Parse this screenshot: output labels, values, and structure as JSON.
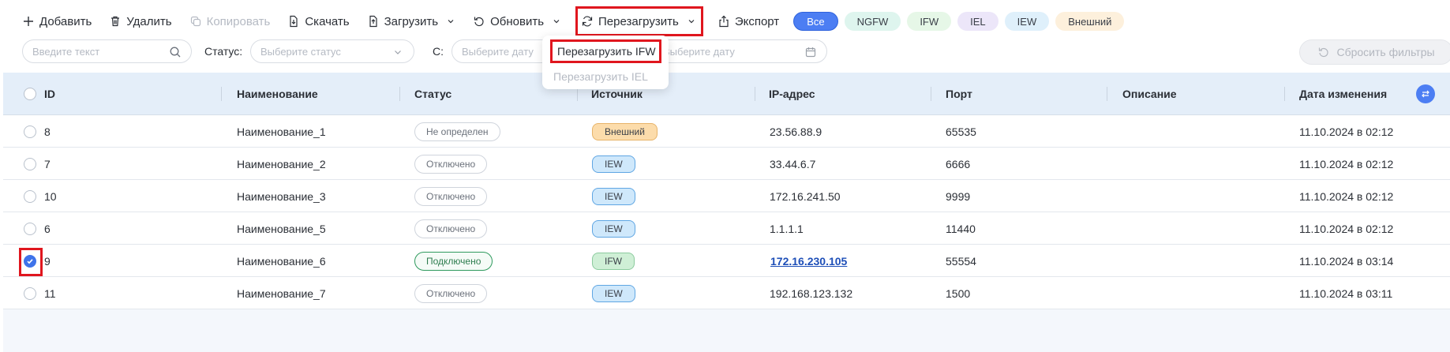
{
  "toolbar": {
    "add": "Добавить",
    "delete": "Удалить",
    "copy": "Копировать",
    "download": "Скачать",
    "upload": "Загрузить",
    "refresh": "Обновить",
    "reload": "Перезагрузить",
    "export": "Экспорт"
  },
  "chips": {
    "all": "Все",
    "ngfw": "NGFW",
    "ifw": "IFW",
    "iel": "IEL",
    "iew": "IEW",
    "ext": "Внешний"
  },
  "filters": {
    "search_placeholder": "Введите текст",
    "status_label": "Статус:",
    "status_placeholder": "Выберите статус",
    "from_label": "С:",
    "date_placeholder": "Выберите дату",
    "date_to_placeholder": "Выберите дату",
    "reset": "Сбросить фильтры"
  },
  "reload_menu": {
    "item_ifw": "Перезагрузить IFW",
    "item_iel": "Перезагрузить IEL"
  },
  "table": {
    "headers": {
      "id": "ID",
      "name": "Наименование",
      "status": "Статус",
      "source": "Источник",
      "ip": "IP-адрес",
      "port": "Порт",
      "description": "Описание",
      "modified": "Дата изменения"
    },
    "rows": [
      {
        "id": "8",
        "name": "Наименование_1",
        "status": "Не определен",
        "source": "Внешний",
        "ip": "23.56.88.9",
        "port": "65535",
        "description": "",
        "modified": "11.10.2024 в 02:12"
      },
      {
        "id": "7",
        "name": "Наименование_2",
        "status": "Отключено",
        "source": "IEW",
        "ip": "33.44.6.7",
        "port": "6666",
        "description": "",
        "modified": "11.10.2024 в 02:12"
      },
      {
        "id": "10",
        "name": "Наименование_3",
        "status": "Отключено",
        "source": "IEW",
        "ip": "172.16.241.50",
        "port": "9999",
        "description": "",
        "modified": "11.10.2024 в 02:12"
      },
      {
        "id": "6",
        "name": "Наименование_5",
        "status": "Отключено",
        "source": "IEW",
        "ip": "1.1.1.1",
        "port": "11440",
        "description": "",
        "modified": "11.10.2024 в 02:12"
      },
      {
        "id": "9",
        "name": "Наименование_6",
        "status": "Подключено",
        "source": "IFW",
        "ip": "172.16.230.105",
        "port": "55554",
        "description": "",
        "modified": "11.10.2024 в 03:14"
      },
      {
        "id": "11",
        "name": "Наименование_7",
        "status": "Отключено",
        "source": "IEW",
        "ip": "192.168.123.132",
        "port": "1500",
        "description": "",
        "modified": "11.10.2024 в 03:11"
      }
    ]
  },
  "colors": {
    "accent": "#4c7ef3",
    "highlight": "#e0161e"
  }
}
